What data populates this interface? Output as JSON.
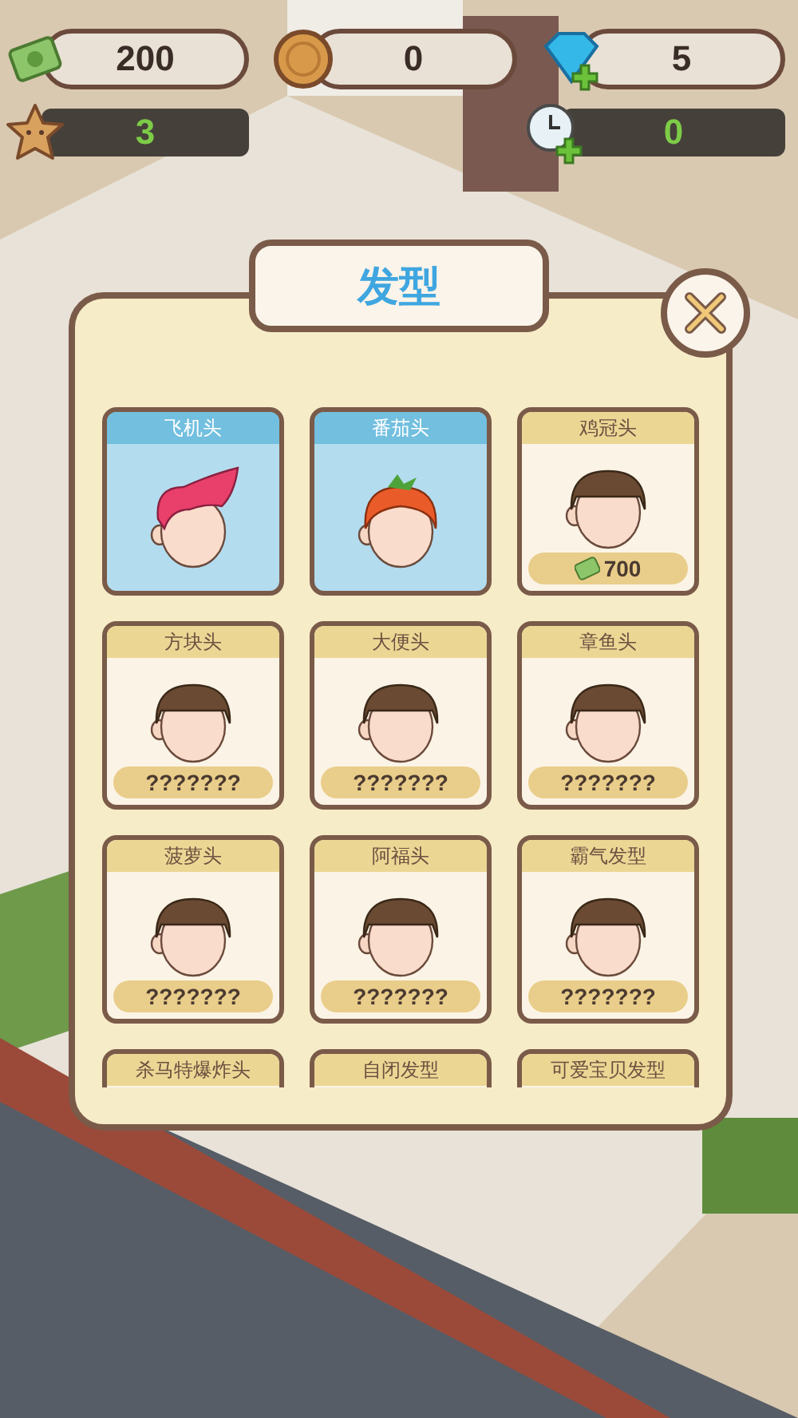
{
  "hud": {
    "cash": "200",
    "coins": "0",
    "gems": "5",
    "stars": "3",
    "time_boost": "0"
  },
  "dialog": {
    "title": "发型",
    "items": [
      {
        "name": "飞机头",
        "kind": "pompadour",
        "owned": true
      },
      {
        "name": "番茄头",
        "kind": "tomato",
        "owned": true
      },
      {
        "name": "鸡冠头",
        "kind": "bowl",
        "owned": false,
        "price": {
          "text": "700",
          "kind": "cash"
        }
      },
      {
        "name": "方块头",
        "kind": "bowl",
        "owned": false,
        "price": {
          "text": "???????",
          "kind": "unknown"
        }
      },
      {
        "name": "大便头",
        "kind": "bowl",
        "owned": false,
        "price": {
          "text": "???????",
          "kind": "unknown"
        }
      },
      {
        "name": "章鱼头",
        "kind": "bowl",
        "owned": false,
        "price": {
          "text": "???????",
          "kind": "unknown"
        }
      },
      {
        "name": "菠萝头",
        "kind": "bowl",
        "owned": false,
        "price": {
          "text": "???????",
          "kind": "unknown"
        }
      },
      {
        "name": "阿福头",
        "kind": "bowl",
        "owned": false,
        "price": {
          "text": "???????",
          "kind": "unknown"
        }
      },
      {
        "name": "霸气发型",
        "kind": "bowl",
        "owned": false,
        "price": {
          "text": "???????",
          "kind": "unknown"
        }
      },
      {
        "name": "杀马特爆炸头",
        "owned": false
      },
      {
        "name": "自闭发型",
        "owned": false
      },
      {
        "name": "可爱宝贝发型",
        "owned": false
      }
    ]
  }
}
